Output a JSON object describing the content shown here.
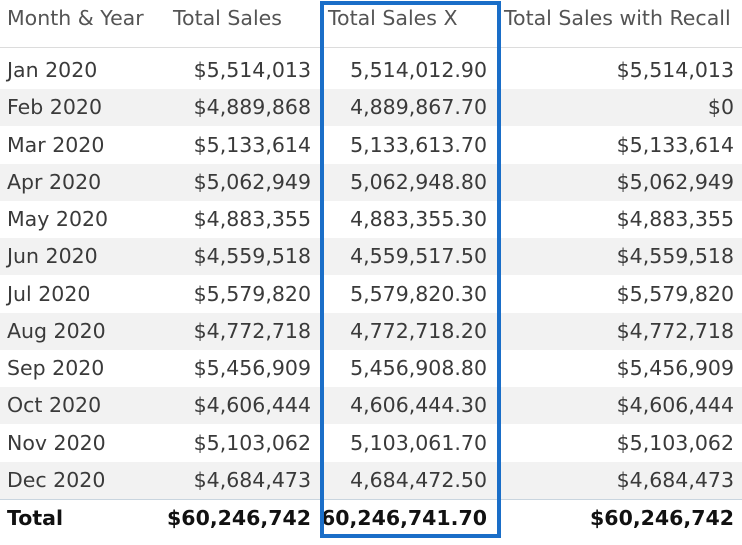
{
  "table": {
    "headers": {
      "month": "Month & Year",
      "total_sales": "Total Sales",
      "total_sales_x": "Total Sales X",
      "total_sales_recall": "Total Sales with Recall"
    },
    "rows": [
      {
        "month": "Jan 2020",
        "total_sales": "$5,514,013",
        "total_sales_x": "5,514,012.90",
        "total_sales_recall": "$5,514,013"
      },
      {
        "month": "Feb 2020",
        "total_sales": "$4,889,868",
        "total_sales_x": "4,889,867.70",
        "total_sales_recall": "$0"
      },
      {
        "month": "Mar 2020",
        "total_sales": "$5,133,614",
        "total_sales_x": "5,133,613.70",
        "total_sales_recall": "$5,133,614"
      },
      {
        "month": "Apr 2020",
        "total_sales": "$5,062,949",
        "total_sales_x": "5,062,948.80",
        "total_sales_recall": "$5,062,949"
      },
      {
        "month": "May 2020",
        "total_sales": "$4,883,355",
        "total_sales_x": "4,883,355.30",
        "total_sales_recall": "$4,883,355"
      },
      {
        "month": "Jun 2020",
        "total_sales": "$4,559,518",
        "total_sales_x": "4,559,517.50",
        "total_sales_recall": "$4,559,518"
      },
      {
        "month": "Jul 2020",
        "total_sales": "$5,579,820",
        "total_sales_x": "5,579,820.30",
        "total_sales_recall": "$5,579,820"
      },
      {
        "month": "Aug 2020",
        "total_sales": "$4,772,718",
        "total_sales_x": "4,772,718.20",
        "total_sales_recall": "$4,772,718"
      },
      {
        "month": "Sep 2020",
        "total_sales": "$5,456,909",
        "total_sales_x": "5,456,908.80",
        "total_sales_recall": "$5,456,909"
      },
      {
        "month": "Oct 2020",
        "total_sales": "$4,606,444",
        "total_sales_x": "4,606,444.30",
        "total_sales_recall": "$4,606,444"
      },
      {
        "month": "Nov 2020",
        "total_sales": "$5,103,062",
        "total_sales_x": "5,103,061.70",
        "total_sales_recall": "$5,103,062"
      },
      {
        "month": "Dec 2020",
        "total_sales": "$4,684,473",
        "total_sales_x": "4,684,472.50",
        "total_sales_recall": "$4,684,473"
      }
    ],
    "total": {
      "label": "Total",
      "total_sales": "$60,246,742",
      "total_sales_x": "60,246,741.70",
      "total_sales_recall": "$60,246,742"
    }
  },
  "colors": {
    "highlight_border": "#1a6ec8",
    "alt_row_background": "#f2f2f2"
  }
}
